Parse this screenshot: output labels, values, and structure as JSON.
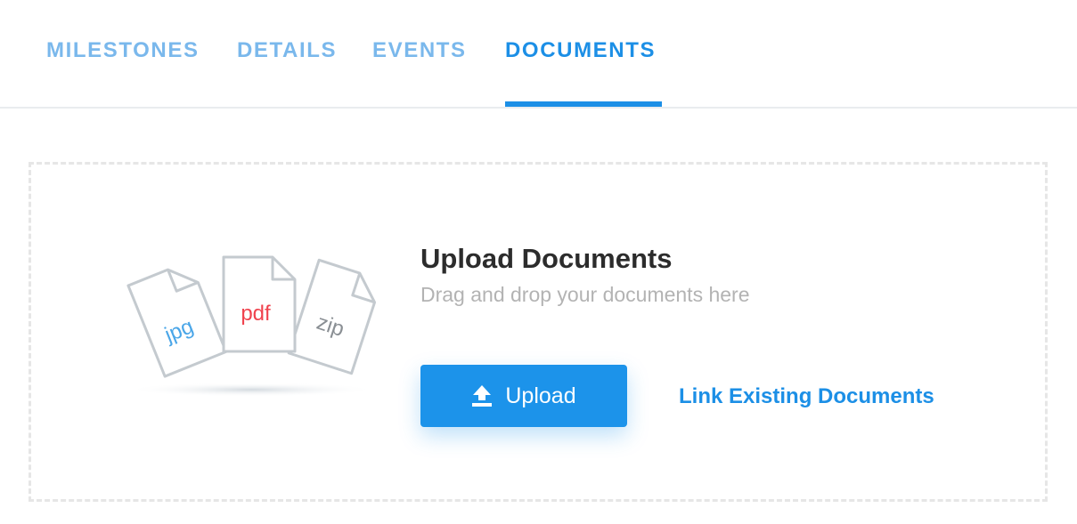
{
  "tabs": [
    {
      "label": "MILESTONES",
      "active": false
    },
    {
      "label": "DETAILS",
      "active": false
    },
    {
      "label": "EVENTS",
      "active": false
    },
    {
      "label": "DOCUMENTS",
      "active": true
    }
  ],
  "upload_panel": {
    "heading": "Upload Documents",
    "subtext": "Drag and drop your documents here",
    "upload_button_label": "Upload",
    "link_existing_label": "Link Existing Documents",
    "file_types": [
      "jpg",
      "pdf",
      "zip"
    ]
  },
  "icons": {
    "upload": "upload-arrow-icon",
    "illustration": "document-files-icon"
  },
  "colors": {
    "accent": "#1c8fe6",
    "tab_inactive": "#7ab8ec",
    "button": "#1c93ea",
    "pdf_label": "#f0434e",
    "jpg_label": "#4aa6e8",
    "zip_label": "#8a8f94",
    "heading": "#2c2c2c",
    "subtext": "#b3b3b3"
  }
}
